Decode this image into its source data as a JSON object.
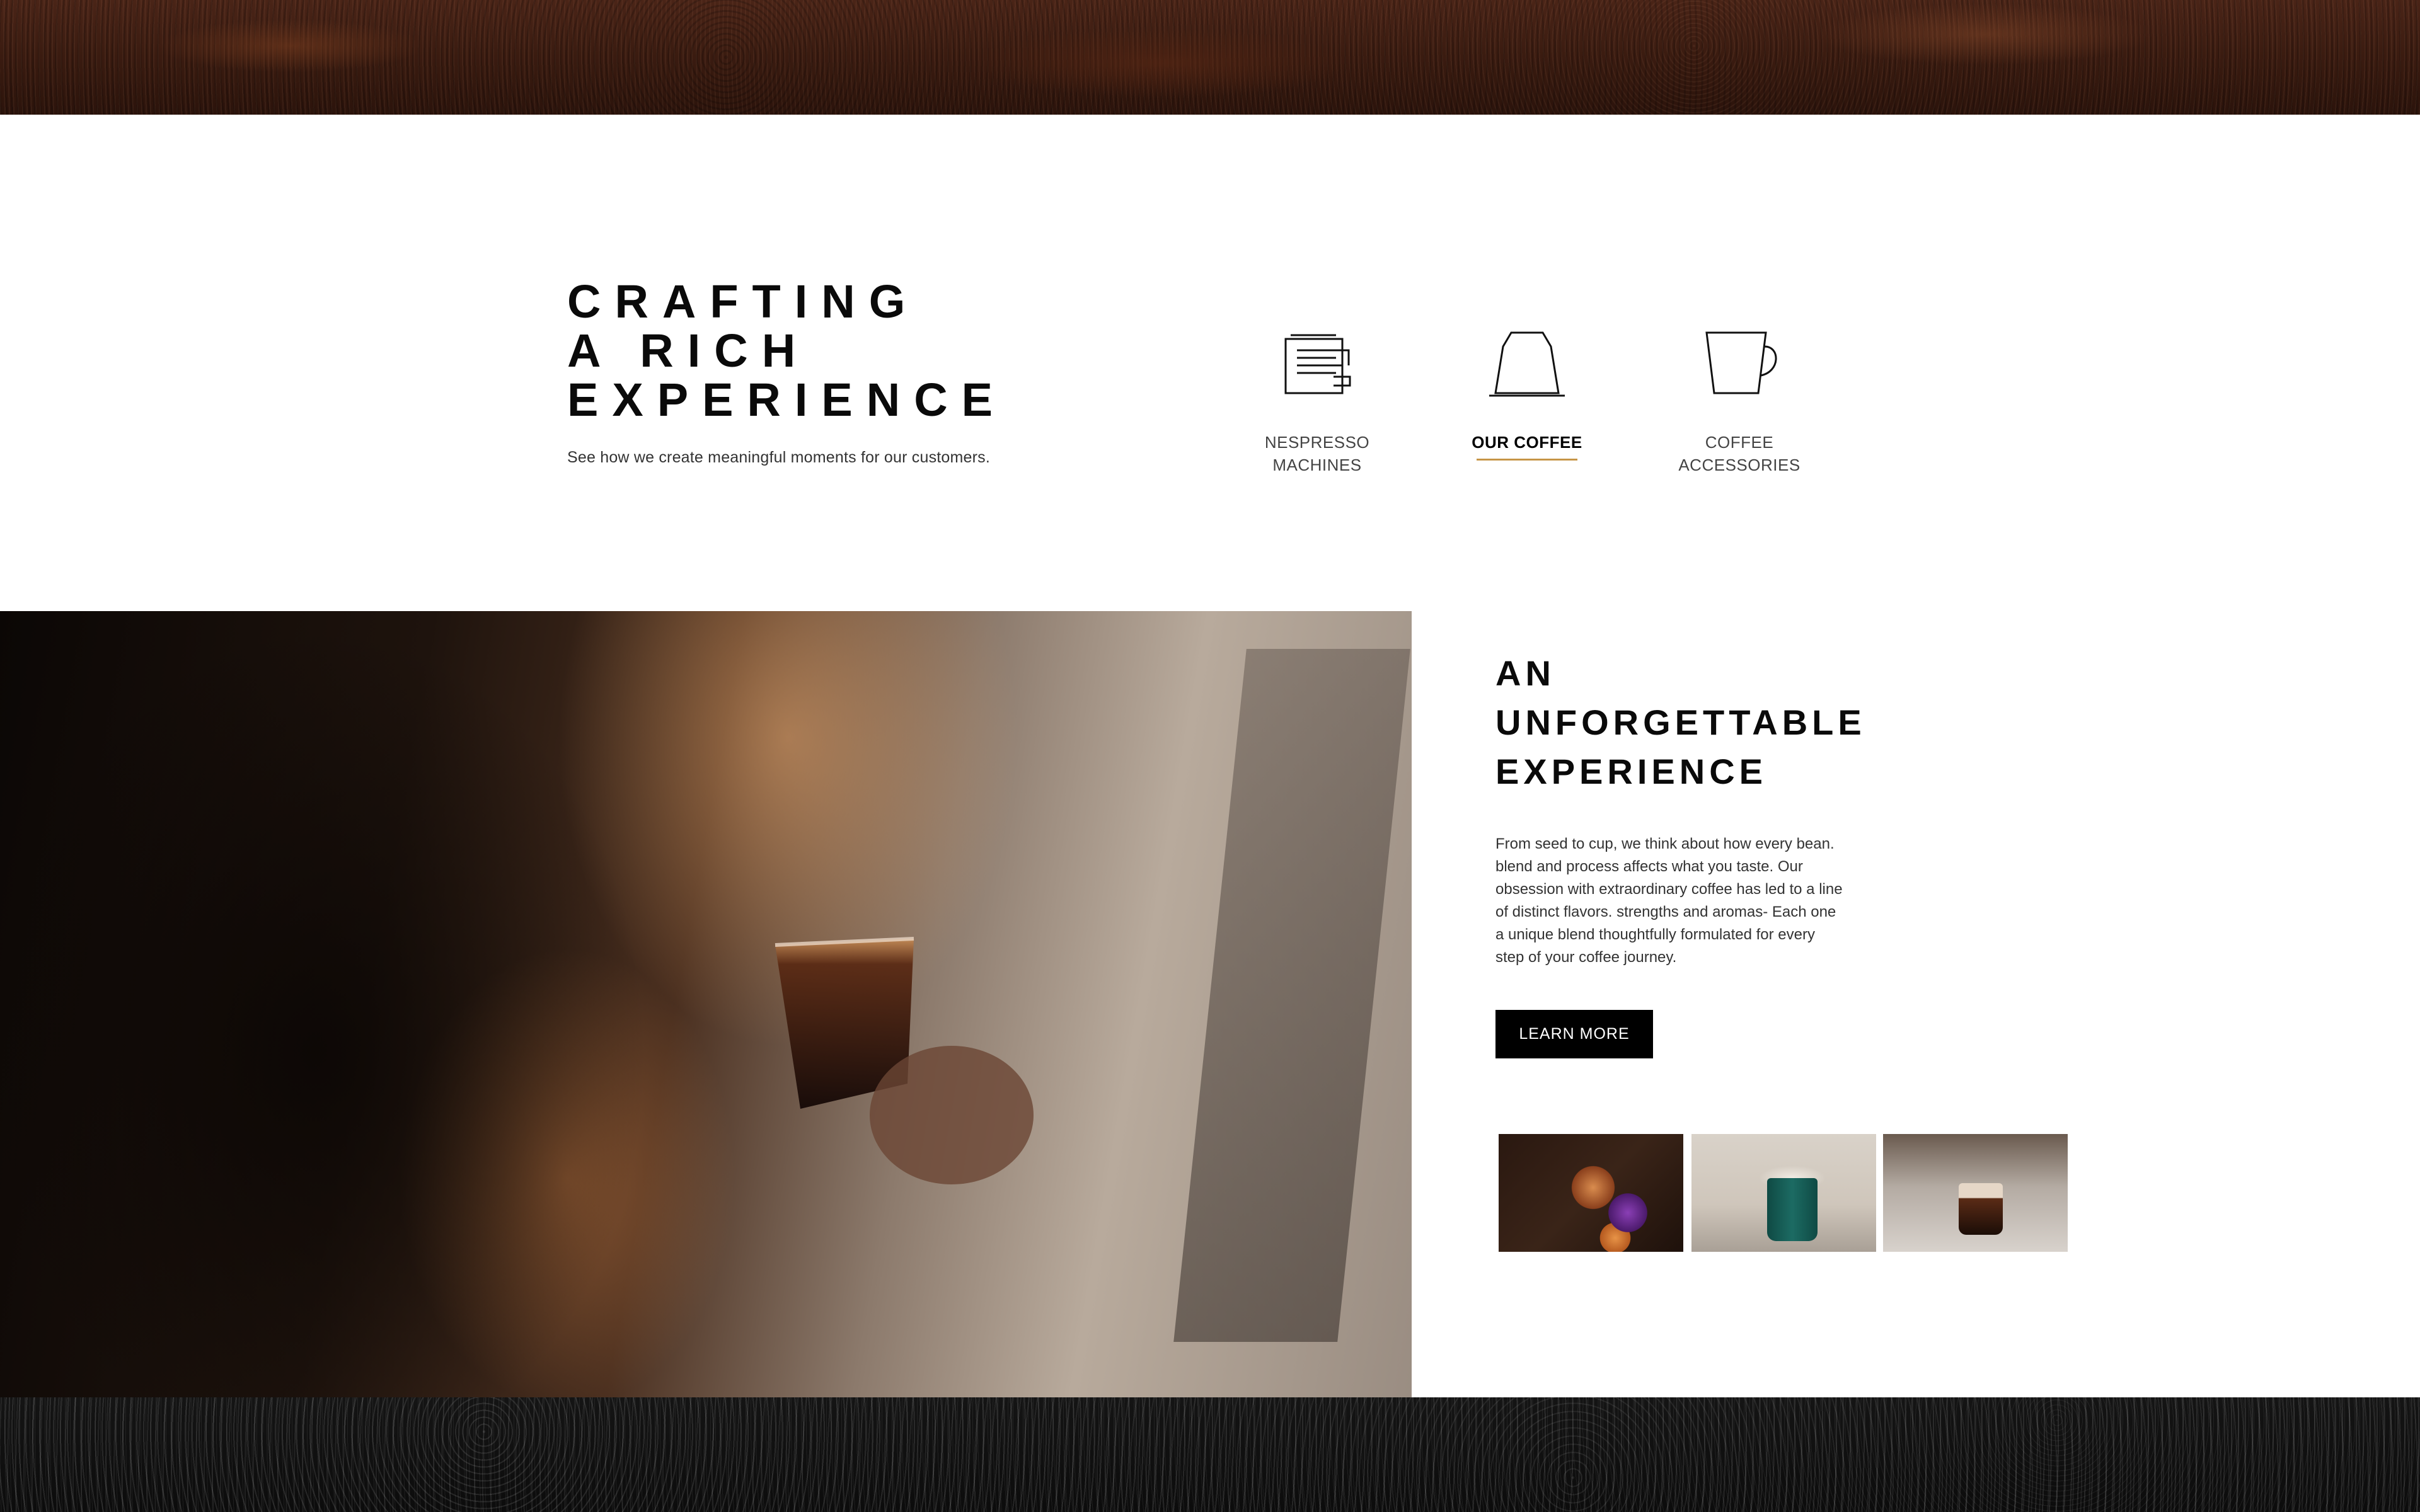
{
  "intro": {
    "title_lines": [
      "CRAFTING",
      "A RICH",
      "EXPERIENCE"
    ],
    "subtitle": "See how we create meaningful moments for our customers."
  },
  "categories": [
    {
      "label_line1": "NESPRESSO",
      "label_line2": "MACHINES",
      "icon": "machine-icon",
      "active": false
    },
    {
      "label_line1": "OUR COFFEE",
      "label_line2": "",
      "icon": "capsule-icon",
      "active": true
    },
    {
      "label_line1": "COFFEE",
      "label_line2": "ACCESSORIES",
      "icon": "cup-icon",
      "active": false
    }
  ],
  "feature": {
    "title_lines": [
      "AN",
      "UNFORGETTABLE",
      "EXPERIENCE"
    ],
    "body": "From seed to cup, we think about how every bean. blend and process affects what you taste. Our obsession with extraordinary coffee has led to a line of distinct flavors. strengths and aromas- Each one a unique blend thoughtfully formulated for every step of your coffee journey.",
    "cta_label": "LEARN MORE"
  },
  "colors": {
    "accent_underline": "#c69547",
    "button_bg": "#000000",
    "button_text": "#ffffff"
  }
}
